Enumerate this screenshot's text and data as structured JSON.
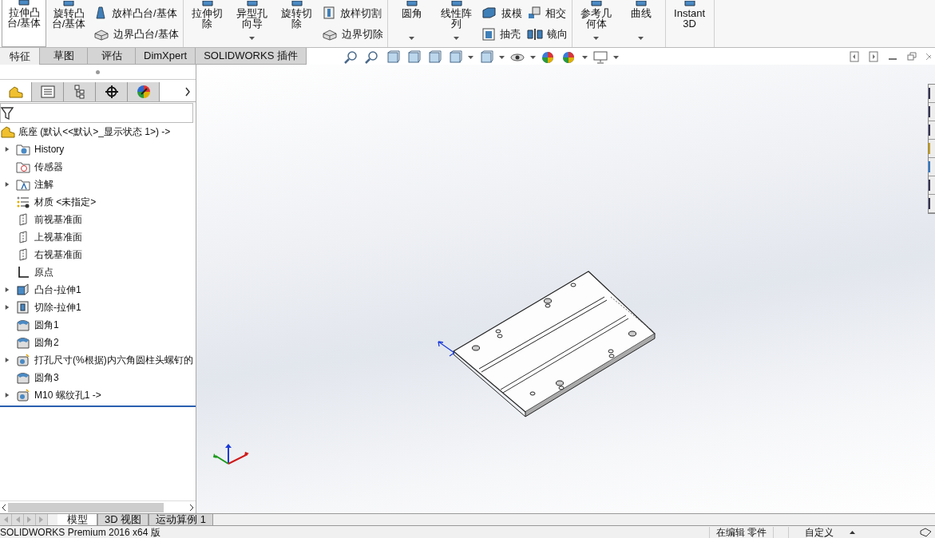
{
  "ribbon": {
    "groups": [
      {
        "columns": [
          {
            "kind": "large",
            "label": "拉伸凸台/基体",
            "selected": true,
            "dropdown": false
          },
          {
            "kind": "large",
            "label": "旋转凸台/基体",
            "selected": false,
            "dropdown": false
          },
          {
            "kind": "stack",
            "items": [
              {
                "label": "放样凸台/基体"
              },
              {
                "label": "边界凸台/基体"
              }
            ]
          }
        ]
      },
      {
        "columns": [
          {
            "kind": "large",
            "label": "拉伸切除",
            "selected": false,
            "dropdown": false
          },
          {
            "kind": "large",
            "label": "异型孔向导",
            "selected": false,
            "dropdown": true
          },
          {
            "kind": "large",
            "label": "旋转切除",
            "selected": false,
            "dropdown": false
          },
          {
            "kind": "stack",
            "items": [
              {
                "label": "放样切割"
              },
              {
                "label": "边界切除"
              }
            ]
          }
        ]
      },
      {
        "columns": [
          {
            "kind": "large",
            "label": "圆角",
            "selected": false,
            "dropdown": true
          },
          {
            "kind": "large",
            "label": "线性阵列",
            "selected": false,
            "dropdown": true
          },
          {
            "kind": "stack",
            "items": [
              {
                "label": "拔模"
              },
              {
                "label": "抽壳"
              }
            ]
          },
          {
            "kind": "stack",
            "items": [
              {
                "label": "相交"
              },
              {
                "label": "镜向"
              }
            ]
          }
        ]
      },
      {
        "columns": [
          {
            "kind": "large",
            "label": "参考几何体",
            "selected": false,
            "dropdown": true
          },
          {
            "kind": "large",
            "label": "曲线",
            "selected": false,
            "dropdown": true
          }
        ]
      },
      {
        "columns": [
          {
            "kind": "large",
            "label": "Instant3D",
            "selected": false,
            "dropdown": false
          }
        ]
      }
    ]
  },
  "command_tabs": [
    {
      "label": "特征",
      "selected": true
    },
    {
      "label": "草图",
      "selected": false
    },
    {
      "label": "评估",
      "selected": false
    },
    {
      "label": "DimXpert",
      "selected": false
    },
    {
      "label": "SOLIDWORKS 插件",
      "selected": false
    }
  ],
  "panel_tabs": [
    {
      "kind": "feature",
      "selected": true
    },
    {
      "kind": "property",
      "selected": false
    },
    {
      "kind": "config",
      "selected": false
    },
    {
      "kind": "dimxpert",
      "selected": false
    },
    {
      "kind": "display",
      "selected": false
    }
  ],
  "tree": {
    "root": "底座 (默认<<默认>_显示状态 1>) ->",
    "items": [
      {
        "label": "History",
        "kind": "history",
        "expanded": false
      },
      {
        "label": "传感器",
        "kind": "sensor"
      },
      {
        "label": "注解",
        "kind": "annotation",
        "expanded": false
      },
      {
        "label": "材质 <未指定>",
        "kind": "material"
      },
      {
        "label": "前视基准面",
        "kind": "plane"
      },
      {
        "label": "上视基准面",
        "kind": "plane"
      },
      {
        "label": "右视基准面",
        "kind": "plane"
      },
      {
        "label": "原点",
        "kind": "origin"
      },
      {
        "label": "凸台-拉伸1",
        "kind": "boss",
        "expanded": false
      },
      {
        "label": "切除-拉伸1",
        "kind": "cut",
        "expanded": false
      },
      {
        "label": "圆角1",
        "kind": "fillet"
      },
      {
        "label": "圆角2",
        "kind": "fillet"
      },
      {
        "label": "打孔尺寸(%根据)内六角圆柱头螺钉的",
        "kind": "hole",
        "expanded": false
      },
      {
        "label": "圆角3",
        "kind": "fillet"
      },
      {
        "label": "M10 螺纹孔1 ->",
        "kind": "hole",
        "expanded": false
      }
    ]
  },
  "bottom_tabs": [
    {
      "label": "模型",
      "selected": true
    },
    {
      "label": "3D 视图",
      "selected": false
    },
    {
      "label": "运动算例 1",
      "selected": false
    }
  ],
  "status_bar": {
    "product": "SOLIDWORKS Premium 2016 x64 版",
    "mode": "在编辑 零件",
    "units": "自定义"
  }
}
